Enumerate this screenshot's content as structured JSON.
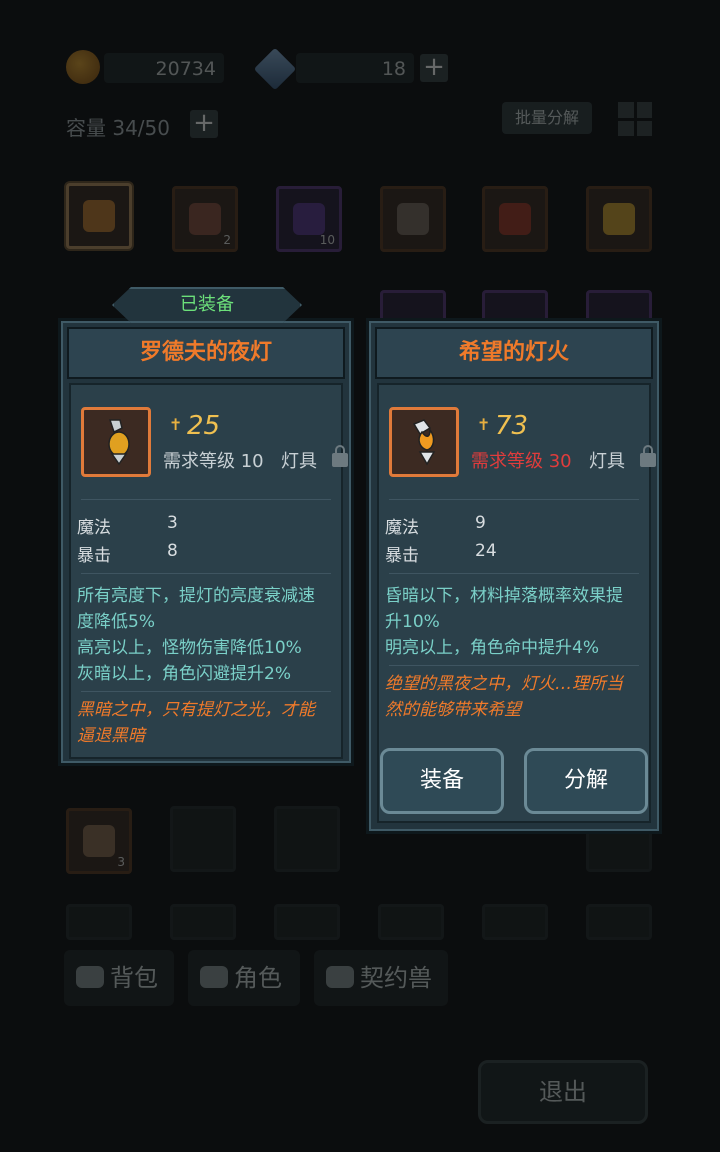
{
  "top_bar": {
    "coins": "20734",
    "gems": "18",
    "capacity_label": "容量 34/50",
    "batch_decompose_label": "批量分解"
  },
  "inventory": {
    "row1_counts": [
      "",
      "2",
      "10",
      "",
      "",
      ""
    ],
    "bottom_item_count": "3"
  },
  "tabs": [
    {
      "label": "背包"
    },
    {
      "label": "角色"
    },
    {
      "label": "契约兽"
    }
  ],
  "exit_label": "退出",
  "equipped_item": {
    "badge": "已装备",
    "name": "罗德夫的夜灯",
    "power": "25",
    "required_level": "需求等级 10",
    "type": "灯具",
    "stats": [
      {
        "name": "魔法",
        "value": "3"
      },
      {
        "name": "暴击",
        "value": "8"
      }
    ],
    "effects": [
      "所有亮度下，提灯的亮度衰减速",
      "度降低5%",
      "高亮以上，怪物伤害降低10%",
      "灰暗以上，角色闪避提升2%"
    ],
    "flavor": [
      "黑暗之中，只有提灯之光，才能",
      "逼退黑暗"
    ]
  },
  "selected_item": {
    "name": "希望的灯火",
    "power": "73",
    "required_level": "需求等级 30",
    "type": "灯具",
    "stats": [
      {
        "name": "魔法",
        "value": "9"
      },
      {
        "name": "暴击",
        "value": "24"
      }
    ],
    "effects": [
      "昏暗以下，材料掉落概率效果提",
      "升10%",
      "明亮以上，角色命中提升4%"
    ],
    "flavor": [
      "绝望的黑夜之中，灯火…理所当",
      "然的能够带来希望"
    ],
    "equip_label": "装备",
    "decompose_label": "分解"
  },
  "colors": {
    "title_orange": "#f07a2a",
    "power_gold": "#f0c050",
    "required_red": "#e03c3c",
    "effect_teal": "#7ad0c8",
    "equipped_green": "#6ce07a"
  }
}
